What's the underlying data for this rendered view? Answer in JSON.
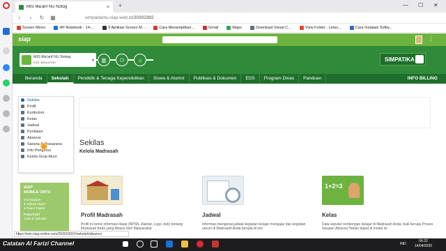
{
  "browser": {
    "tab_title": "MIS Ma'arif NU Notog",
    "url_prefix": "simpadamu.siap.web.id/",
    "url_path": "20302392",
    "status_url": "https://sim.siap-online.com/20302392#!sekolah/absensi",
    "bookmarks": [
      {
        "label": "Screen Mirror",
        "color": "#e23b2e"
      },
      {
        "label": "HP Notebook - 14-...",
        "color": "#1f6fd1"
      },
      {
        "label": "5 Aplikasi Screen M...",
        "color": "#333333"
      },
      {
        "label": "Cara Menampilkan...",
        "color": "#d63a2a"
      },
      {
        "label": "Gmail",
        "color": "#d93025"
      },
      {
        "label": "Maps",
        "color": "#34a853"
      },
      {
        "label": "Download Visual C...",
        "color": "#5b6f86"
      },
      {
        "label": "View Folder - Letsu...",
        "color": "#e04a2e"
      },
      {
        "label": "Cara Instalasi Softw...",
        "color": "#1f6fd1"
      }
    ]
  },
  "header": {
    "logo": "siap",
    "school_name": "MIS Ma'arif NU Notog",
    "school_sub": "Kab. Banyumas",
    "badge": "SIMPATIKA"
  },
  "nav": {
    "items": [
      "Beranda",
      "Sekolah",
      "Pendidik & Tenaga Kependidikan",
      "Siswa & Alumni",
      "Publikasi & Dokumen",
      "EDS",
      "Program Dinas",
      "Panduan"
    ],
    "active": "Sekolah",
    "info": "INFO BILLING"
  },
  "dropdown": {
    "items": [
      "Sekilas",
      "Profil",
      "Kurikulum",
      "Kelas",
      "Jadwal",
      "Penilaian",
      "Absensi",
      "Sarana & Prasarana",
      "Info Pengurus",
      "Kelola Grup Akun"
    ],
    "selected": "Sekilas"
  },
  "promo": {
    "title1": "SIAP",
    "title2": "MOBILE ORTU",
    "items": [
      "Kehadiran",
      "Jadwal Mapel",
      "Rapor Digital"
    ],
    "foot1": "Putra-Putri",
    "foot2": "Anda di Sekolah"
  },
  "main": {
    "title": "Sekilas",
    "subtitle": "Kelola Madrasah",
    "cards": [
      {
        "title": "Profil Madrasah",
        "desc": "Profil ini berisi informasi dasar (NPSN, Alamat, Logo, dsb) tentang Madrasah Anda yang dibaca oleh Masyarakat",
        "color": "#f0e6c8"
      },
      {
        "title": "Jadwal",
        "desc": "Informasi mengenai jadwal kegiatan belajar mengajar dan kegiatan umum di Madrasah Anda berada di sini",
        "color": "#e6ecef"
      },
      {
        "title": "Kelas",
        "desc": "Data seputar rombongan belajar di Madrasah Anda, baik berupa Proses maupun Absensi Harian dapat di modul ini",
        "color": "#6cb33f"
      }
    ],
    "card3_text": "1+2=3"
  },
  "taskbar": {
    "channel": "Catatan Al Farizi Channel",
    "time": "04.22",
    "date": "14/04/2020",
    "lang": "IND"
  }
}
